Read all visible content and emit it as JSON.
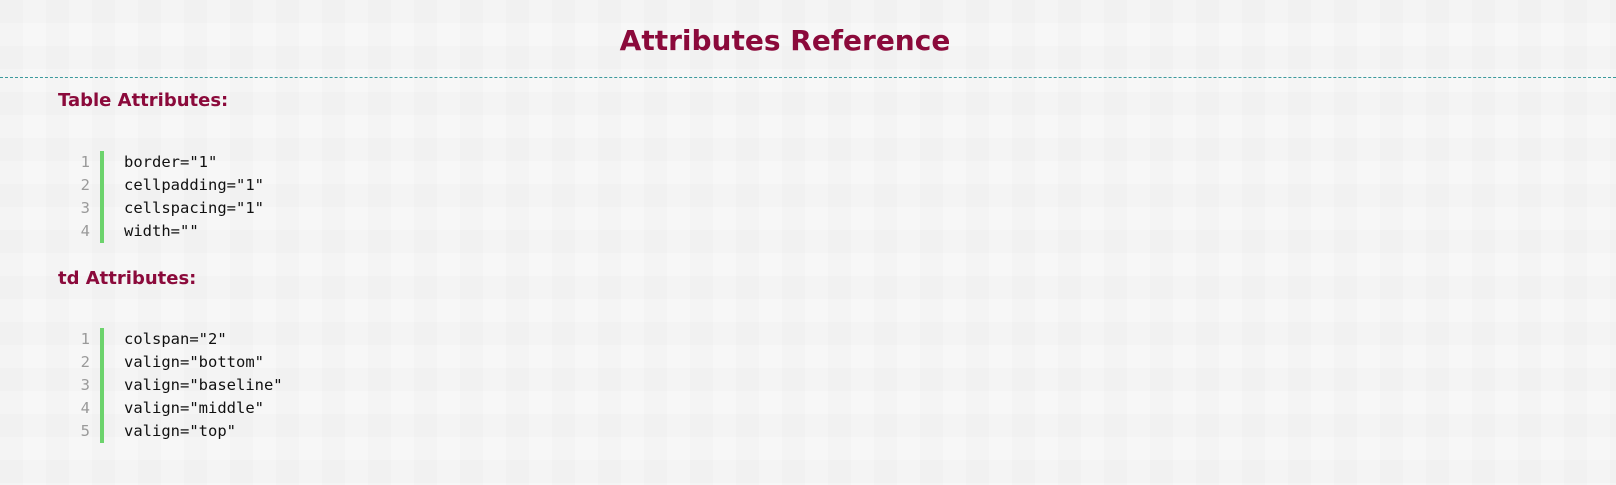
{
  "title": "Attributes Reference",
  "sections": [
    {
      "heading": "Table Attributes:",
      "lines": [
        "border=\"1\"",
        "cellpadding=\"1\"",
        "cellspacing=\"1\"",
        "width=\"\""
      ]
    },
    {
      "heading": "td Attributes:",
      "lines": [
        "colspan=\"2\"",
        "valign=\"bottom\"",
        "valign=\"baseline\"",
        "valign=\"middle\"",
        "valign=\"top\""
      ]
    }
  ]
}
